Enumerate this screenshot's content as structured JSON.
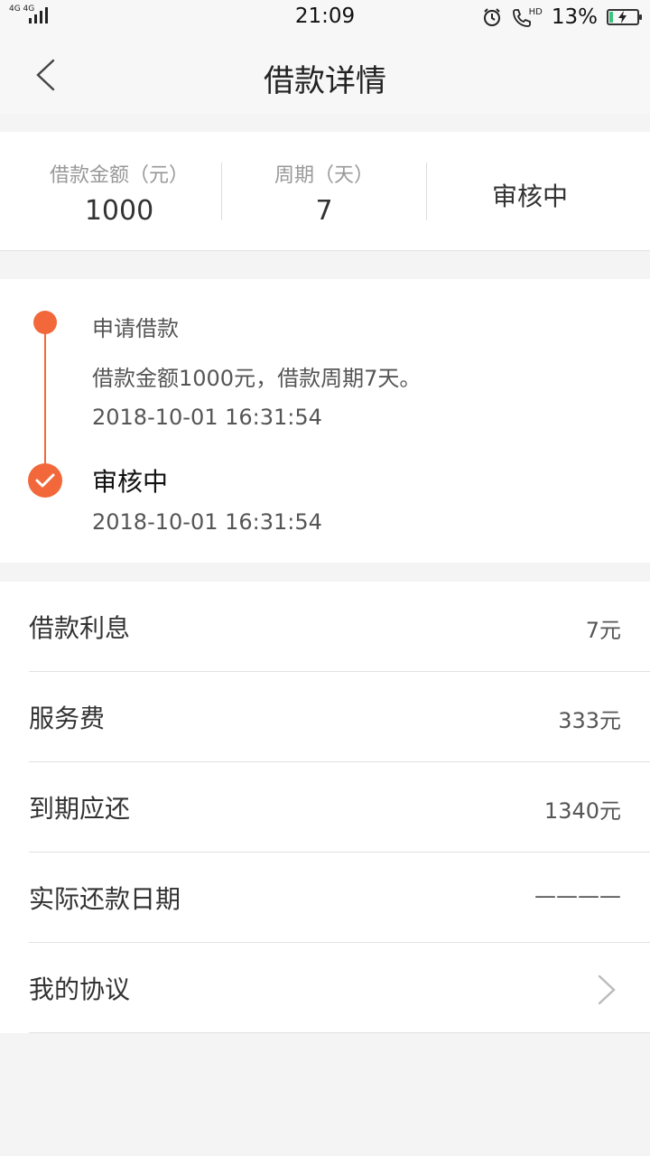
{
  "status_bar": {
    "network": "4G 4G",
    "time": "21:09",
    "hd": "HD",
    "battery_percent": "13%",
    "battery_level": 0.13,
    "icons": [
      "signal-icon",
      "alarm-icon",
      "hd-call-icon",
      "battery-charging-icon"
    ]
  },
  "navbar": {
    "title": "借款详情",
    "back_icon": "chevron-left-icon"
  },
  "summary": {
    "amount_label": "借款金额（元）",
    "amount_value": "1000",
    "period_label": "周期（天）",
    "period_value": "7",
    "status": "审核中"
  },
  "timeline": {
    "accent_color": "#f2683a",
    "steps": [
      {
        "title": "申请借款",
        "description": "借款金额1000元，借款周期7天。",
        "time": "2018-10-01 16:31:54"
      },
      {
        "title": "审核中",
        "time": "2018-10-01 16:31:54"
      }
    ]
  },
  "details": {
    "rows": [
      {
        "label": "借款利息",
        "value": "7元"
      },
      {
        "label": "服务费",
        "value": "333元"
      },
      {
        "label": "到期应还",
        "value": "1340元"
      },
      {
        "label": "实际还款日期",
        "value": "————"
      },
      {
        "label": "我的协议",
        "value": ""
      }
    ],
    "chevron_icon": "chevron-right-icon"
  }
}
